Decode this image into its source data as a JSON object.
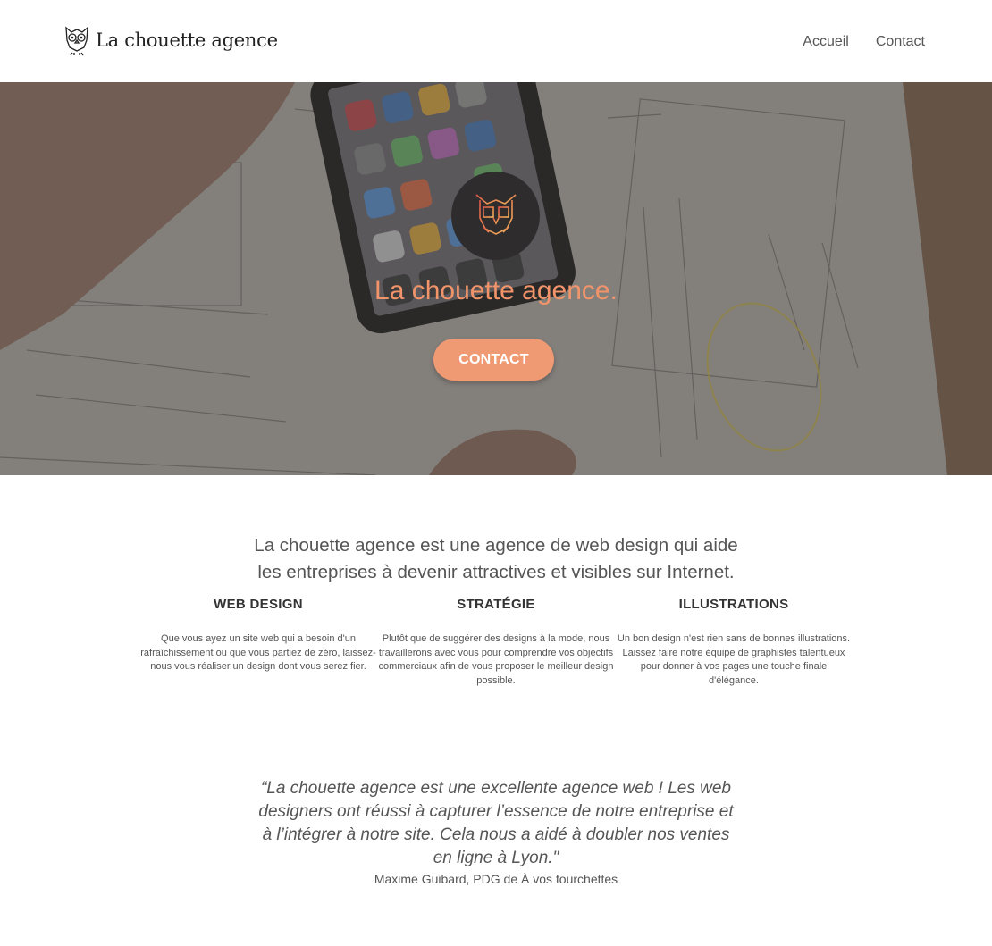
{
  "header": {
    "logo_text": "La chouette agence",
    "nav": [
      {
        "label": "Accueil"
      },
      {
        "label": "Contact"
      }
    ]
  },
  "hero": {
    "title": "La chouette agence.",
    "cta_label": "CONTACT",
    "accent_color": "#f1946a"
  },
  "intro": {
    "line1": "La chouette agence est une agence de web design qui aide",
    "line2": "les entreprises à devenir attractives et visibles sur Internet."
  },
  "services": [
    {
      "title": "WEB DESIGN",
      "text": "Que vous ayez un site web qui a besoin d'un rafraîchissement ou que vous partiez de zéro, laissez-nous vous réaliser un design dont vous serez fier."
    },
    {
      "title": "STRATÉGIE",
      "text": "Plutôt que de suggérer des designs à la mode, nous travaillerons avec vous pour comprendre vos objectifs commerciaux afin de vous proposer le meilleur design possible."
    },
    {
      "title": "ILLUSTRATIONS",
      "text": "Un bon design n'est rien sans de bonnes illustrations. Laissez faire notre équipe de graphistes talentueux pour donner à vos pages une touche finale d'élégance."
    }
  ],
  "testimonial": {
    "quote": "“La chouette agence est une excellente agence web ! Les web designers ont réussi à capturer l’essence de notre entreprise et à l’intégrer à notre site. Cela nous a aidé à doubler nos ventes en ligne à Lyon.\"",
    "author": "Maxime Guibard, PDG de À vos fourchettes"
  }
}
